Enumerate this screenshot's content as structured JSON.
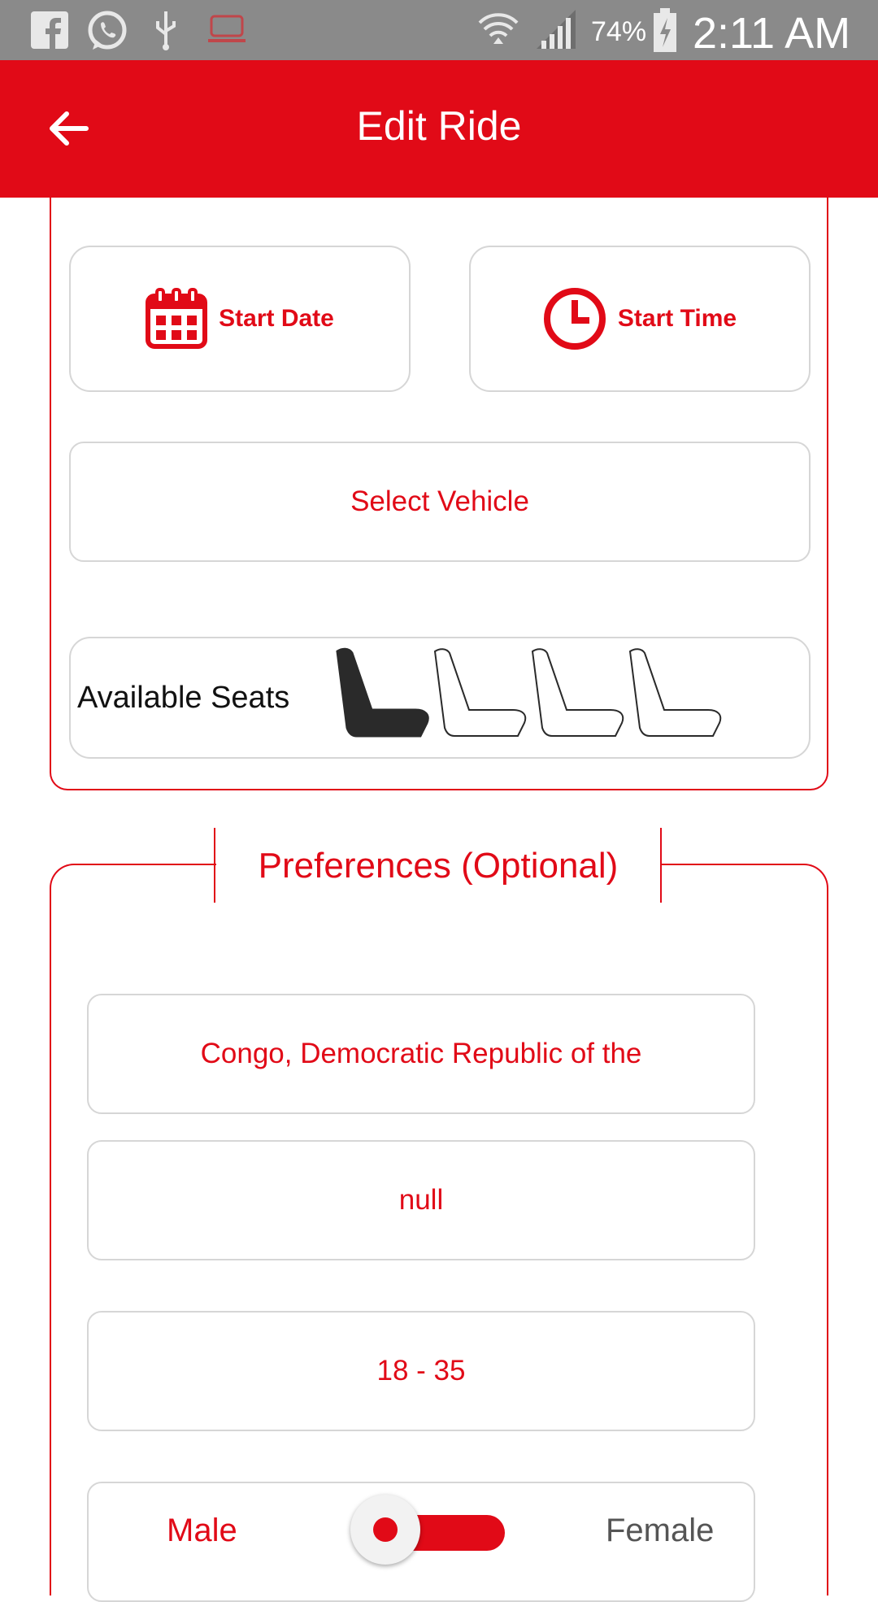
{
  "status_bar": {
    "battery_percent": "74%",
    "time": "2:11 AM",
    "icons": [
      "facebook-icon",
      "whatsapp-icon",
      "usb-icon",
      "app-icon",
      "wifi-icon",
      "signal-icon",
      "battery-charging-icon"
    ]
  },
  "app_bar": {
    "title": "Edit Ride",
    "back_icon": "arrow-left-icon"
  },
  "ride": {
    "start_date_label": "Start Date",
    "start_time_label": "Start Time",
    "select_vehicle_label": "Select Vehicle",
    "available_seats_label": "Available Seats",
    "seats_total": 4,
    "seats_selected": 1
  },
  "preferences": {
    "title": "Preferences (Optional)",
    "country": "Congo, Democratic Republic of the",
    "field_two": "null",
    "age_range": "18 - 35",
    "gender_male_label": "Male",
    "gender_female_label": "Female"
  },
  "colors": {
    "accent": "#e10a17",
    "status_bar": "#8a8a8a",
    "border_gray": "#d6d6d6"
  }
}
